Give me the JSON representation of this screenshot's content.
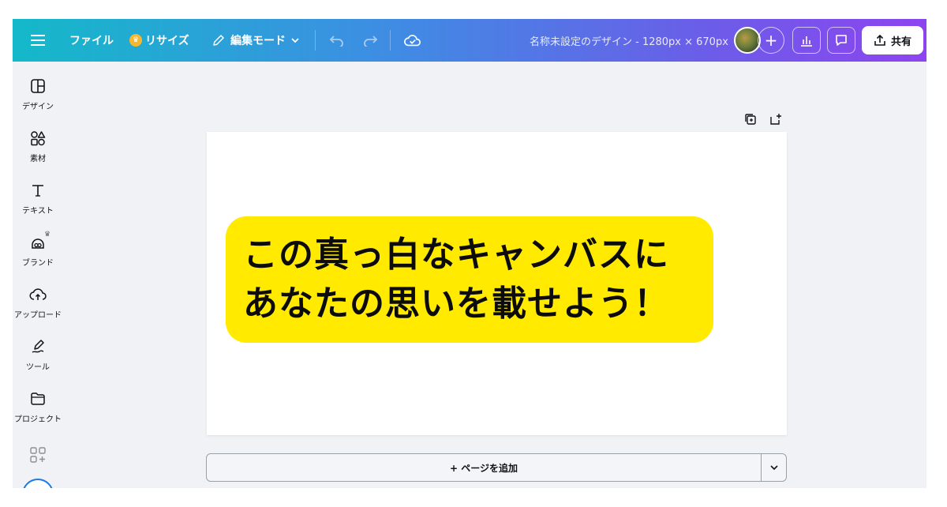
{
  "toolbar": {
    "file_label": "ファイル",
    "resize_label": "リサイズ",
    "edit_mode_label": "編集モード",
    "doc_title": "名称未設定のデザイン - 1280px × 670px",
    "add_collaborator_label": "+",
    "share_label": "共有"
  },
  "sidebar": {
    "items": [
      {
        "label": "デザイン",
        "icon": "layout-icon"
      },
      {
        "label": "素材",
        "icon": "elements-icon"
      },
      {
        "label": "テキスト",
        "icon": "text-icon"
      },
      {
        "label": "ブランド",
        "icon": "brand-icon"
      },
      {
        "label": "アップロード",
        "icon": "upload-cloud-icon"
      },
      {
        "label": "ツール",
        "icon": "draw-icon"
      },
      {
        "label": "プロジェクト",
        "icon": "folder-icon"
      }
    ]
  },
  "canvas": {
    "line1": "この真っ白なキャンバスに",
    "line2": "あなたの思いを載せよう！",
    "highlight_color": "#ffea00"
  },
  "footer": {
    "add_page_label": "+ ページを追加"
  },
  "colors": {
    "gradient_start": "#14b9c9",
    "gradient_end": "#8d44ef",
    "workspace_bg": "#f1f2f6"
  }
}
